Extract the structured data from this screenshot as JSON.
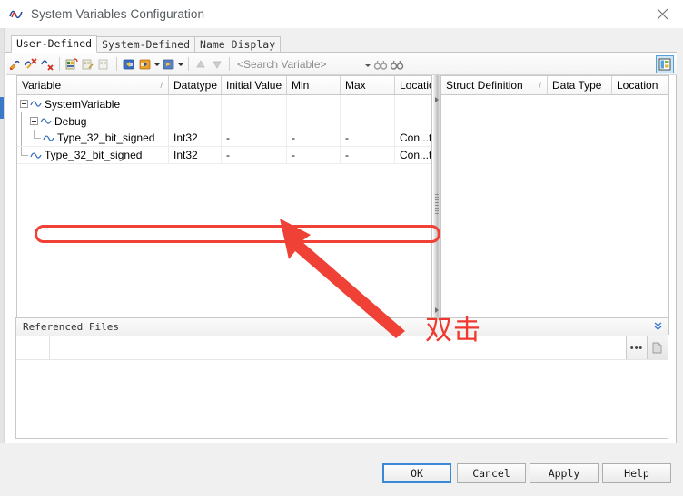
{
  "window": {
    "title": "System Variables Configuration",
    "app_icon": "wave-icon",
    "close_label": "✕"
  },
  "tabs": [
    {
      "label": "User-Defined",
      "active": true
    },
    {
      "label": "System-Defined",
      "active": false
    },
    {
      "label": "Name Display",
      "active": false
    }
  ],
  "toolbar": {
    "icons": [
      "new-variable-icon",
      "import-variable-icon",
      "delete-variable-icon",
      "new-struct-icon",
      "edit-struct-icon",
      "delete-struct-icon",
      "import-icon",
      "export-icon",
      "refresh-icon",
      "move-up-icon",
      "move-down-icon"
    ],
    "search_placeholder": "<Search Variable>",
    "find_icon": "binoculars-icon",
    "find_next_icon": "binoculars-next-icon",
    "right_toggle_icon": "show-struct-panel-icon"
  },
  "left_grid": {
    "columns": [
      "Variable",
      "Datatype",
      "Initial Value",
      "Min",
      "Max",
      "Location"
    ],
    "sort_column": "Variable",
    "rows": [
      {
        "name": "SystemVariable",
        "depth": 0,
        "expander": "collapse",
        "icon": "variable-group-icon",
        "datatype": "",
        "initial_value": "",
        "min": "",
        "max": "",
        "location": ""
      },
      {
        "name": "Debug",
        "depth": 1,
        "expander": "collapse",
        "icon": "variable-group-icon",
        "datatype": "",
        "initial_value": "",
        "min": "",
        "max": "",
        "location": ""
      },
      {
        "name": "Type_32_bit_signed",
        "depth": 2,
        "expander": "none",
        "icon": "variable-icon",
        "datatype": "Int32",
        "initial_value": "-",
        "min": "-",
        "max": "-",
        "location": "Con...tion"
      },
      {
        "name": "Type_32_bit_signed",
        "depth": 1,
        "expander": "none",
        "icon": "variable-icon",
        "datatype": "Int32",
        "initial_value": "-",
        "min": "-",
        "max": "-",
        "location": "Con...tion",
        "highlighted": true
      }
    ]
  },
  "right_grid": {
    "columns": [
      "Struct Definition",
      "Data Type",
      "Location"
    ],
    "sort_column": "Struct Definition",
    "rows": []
  },
  "referenced_files": {
    "title": "Referenced Files",
    "collapse_icon": "chevron-double-down-icon",
    "browse_label": "•••",
    "doc_icon": "document-icon",
    "value": ""
  },
  "annotation": {
    "text": "双击",
    "color": "#f0382f",
    "highlight_color": "#ef4136",
    "arrow": "up-left-arrow"
  },
  "buttons": [
    {
      "label": "OK",
      "primary": true
    },
    {
      "label": "Cancel",
      "primary": false
    },
    {
      "label": "Apply",
      "primary": false
    },
    {
      "label": "Help",
      "primary": false
    }
  ],
  "colors": {
    "accent": "#3a88d8",
    "annotation_red": "#ef4136",
    "window_bg": "#f0f0f0"
  }
}
